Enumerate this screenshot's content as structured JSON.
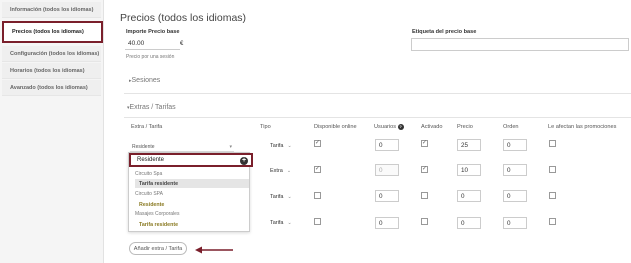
{
  "sidebar": {
    "items": [
      {
        "label": "Información (todos los idiomas)"
      },
      {
        "label": "Precios (todos los idiomas)"
      },
      {
        "label": "Configuración (todos los idiomas)"
      },
      {
        "label": "Horarios (todos los idiomas)"
      },
      {
        "label": "Avanzado (todos los idiomas)"
      }
    ]
  },
  "main": {
    "title": "Precios (todos los idiomas)",
    "price_label": "Importe Precio base",
    "price_value": "40.00",
    "currency": "€",
    "price_hint": "Precio por una sesión",
    "tag_label": "Etiqueta del precio base",
    "tag_value": "",
    "sessions_label": "Sesiones",
    "extras_label": "Extras / Tarifas"
  },
  "table": {
    "headers": [
      "Extra / Tarifa",
      "Tipo",
      "Disponible online",
      "Usuarios",
      "Activado",
      "Precio",
      "Orden",
      "Le afectan las promociones"
    ],
    "rows": [
      {
        "tarifa": "Residente",
        "tipo": "Tarifa",
        "online": true,
        "usuarios": "0",
        "activado": true,
        "precio": "25",
        "orden": "0",
        "promo": false
      },
      {
        "tarifa": "",
        "tipo": "Extra",
        "online": true,
        "usuarios": "0",
        "activado": true,
        "precio": "10",
        "orden": "0",
        "promo": false
      },
      {
        "tarifa": "",
        "tipo": "Tarifa",
        "online": false,
        "usuarios": "0",
        "activado": false,
        "precio": "0",
        "orden": "0",
        "promo": false
      },
      {
        "tarifa": "",
        "tipo": "Tarifa",
        "online": false,
        "usuarios": "0",
        "activado": false,
        "precio": "0",
        "orden": "0",
        "promo": false
      }
    ]
  },
  "dropdown": {
    "search_value": "Residente",
    "groups": [
      {
        "name": "Circuito Spa",
        "option": "Tarifa residente"
      },
      {
        "name": "Circuito SPA",
        "option": "Residente"
      },
      {
        "name": "Masajes Corporales",
        "option": "Tarifa residente"
      }
    ]
  },
  "add_button": "Añadir extra / Tarifa",
  "colors": {
    "accent": "#7a1f2b",
    "option_gold": "#8a7a22"
  }
}
